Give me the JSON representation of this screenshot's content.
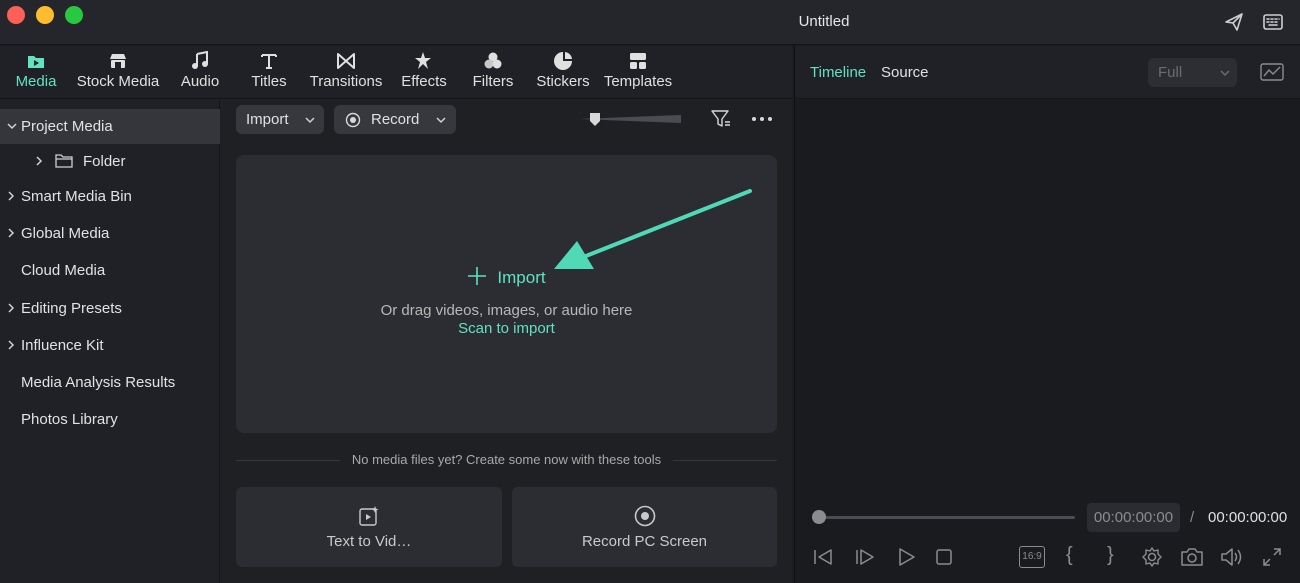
{
  "window": {
    "title": "Untitled"
  },
  "nav": {
    "items": [
      {
        "label": "Media",
        "icon": "media-folder-icon"
      },
      {
        "label": "Stock Media",
        "icon": "stock-media-icon"
      },
      {
        "label": "Audio",
        "icon": "music-note-icon"
      },
      {
        "label": "Titles",
        "icon": "title-t-icon"
      },
      {
        "label": "Transitions",
        "icon": "transition-icon"
      },
      {
        "label": "Effects",
        "icon": "effects-icon"
      },
      {
        "label": "Filters",
        "icon": "filters-icon"
      },
      {
        "label": "Stickers",
        "icon": "sticker-icon"
      },
      {
        "label": "Templates",
        "icon": "templates-icon"
      }
    ],
    "active": "Media",
    "accent": "#5fe3c0"
  },
  "sidebar": {
    "items": [
      {
        "label": "Project Media"
      },
      {
        "label": "Folder"
      },
      {
        "label": "Smart Media Bin"
      },
      {
        "label": "Global Media"
      },
      {
        "label": "Cloud Media"
      },
      {
        "label": "Editing Presets"
      },
      {
        "label": "Influence Kit"
      },
      {
        "label": "Media Analysis Results"
      },
      {
        "label": "Photos Library"
      }
    ]
  },
  "toolbar": {
    "import_label": "Import",
    "record_label": "Record"
  },
  "dropzone": {
    "import_label": "Import",
    "hint": "Or drag videos, images, or audio here",
    "scan_label": "Scan to import"
  },
  "empty_state": {
    "message": "No media files yet? Create some now with these tools",
    "tools": [
      {
        "label": "Text to Vid…",
        "icon": "text-to-video-icon"
      },
      {
        "label": "Record PC Screen",
        "icon": "record-screen-icon"
      }
    ]
  },
  "preview": {
    "tabs": [
      "Timeline",
      "Source"
    ],
    "active_tab": "Timeline",
    "quality": "Full",
    "current_time": "00:00:00:00",
    "separator": "/",
    "total_time": "00:00:00:00",
    "aspect_label": "16:9"
  }
}
